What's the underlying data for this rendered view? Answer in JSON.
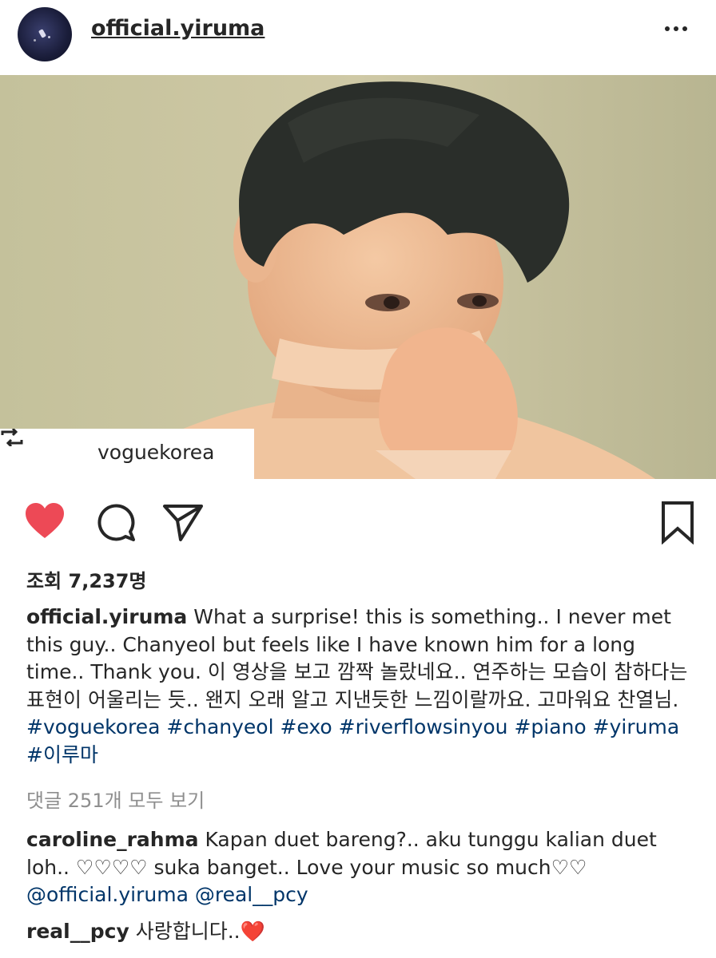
{
  "header": {
    "username": "official.yiruma",
    "more_icon": "more-horizontal-icon"
  },
  "media": {
    "repost_from": "voguekorea",
    "repost_icon": "repost-icon"
  },
  "actions": {
    "like_icon": "heart-filled-icon",
    "like_color": "#ed4956",
    "comment_icon": "comment-icon",
    "share_icon": "send-icon",
    "save_icon": "bookmark-icon"
  },
  "views": "조회 7,237명",
  "caption": {
    "username": "official.yiruma",
    "text": " What a surprise! this is something.. I never met this guy.. Chanyeol but feels like I have known him for a long time.. Thank you. 이 영상을 보고 깜짝 놀랐네요.. 연주하는 모습이 참하다는 표현이 어울리는 듯.. 왠지 오래 알고 지낸듯한 느낌이랄까요. 고마워요 찬열님. ",
    "hashtags": [
      "#voguekorea",
      "#chanyeol",
      "#exo",
      "#riverflowsinyou",
      "#piano",
      "#yiruma",
      "#이루마"
    ]
  },
  "view_all_comments": "댓글 251개 모두 보기",
  "comments": [
    {
      "username": "caroline_rahma",
      "text": " Kapan duet bareng?.. aku tunggu kalian duet loh.. ♡♡♡♡ suka banget.. Love your music so much♡♡ ",
      "mentions": [
        "@official.yiruma",
        "@real__pcy"
      ]
    },
    {
      "username": "real__pcy",
      "text": " 사랑합니다..",
      "emoji": "❤️"
    }
  ]
}
